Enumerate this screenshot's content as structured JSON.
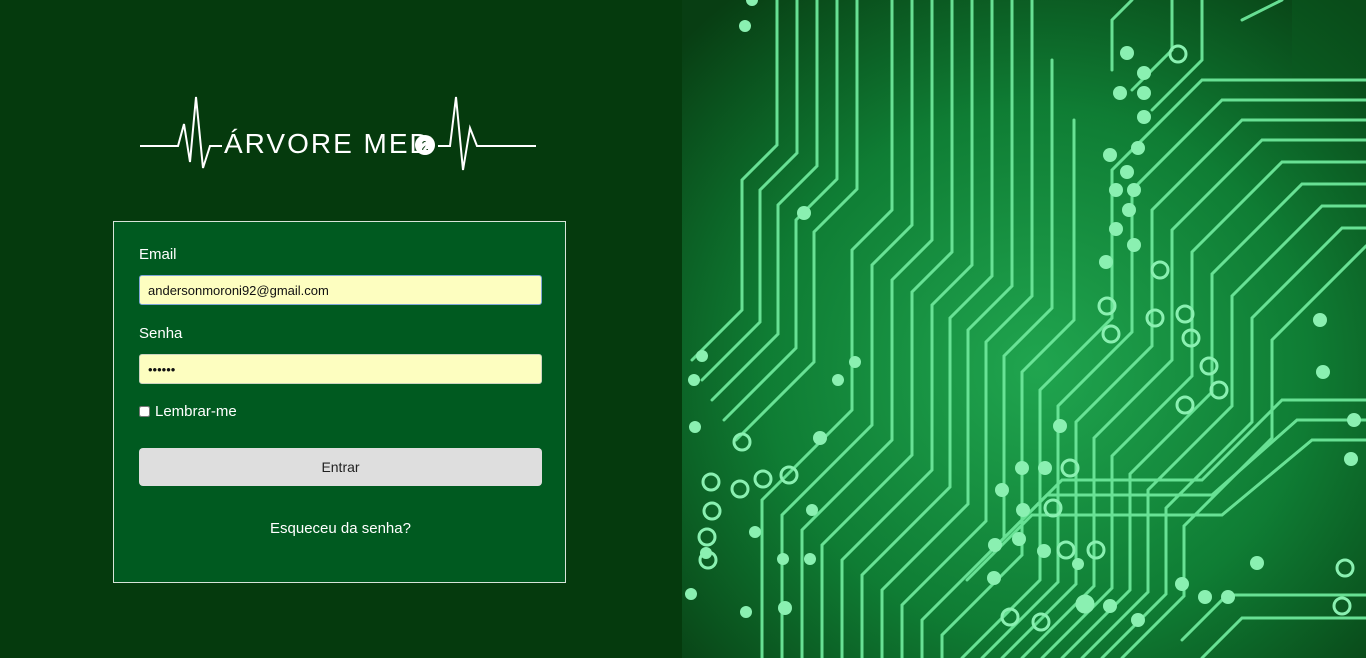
{
  "brand": {
    "name": "ÁRVORE MED",
    "version_mark": "2"
  },
  "form": {
    "email_label": "Email",
    "email_value": "andersonmoroni92@gmail.com",
    "password_label": "Senha",
    "password_value": "••••••",
    "remember_label": "Lembrar-me",
    "submit_label": "Entrar",
    "forgot_link": "Esqueceu da senha?"
  },
  "colors": {
    "left_background": "#053a0d",
    "card_background": "#005a20",
    "input_autofill": "#fdfec0",
    "button": "#dedede",
    "circuit_glow": "#6de79a"
  },
  "icons": {
    "heartbeat": "heartbeat-line-icon",
    "circuit": "circuit-board-illustration"
  }
}
